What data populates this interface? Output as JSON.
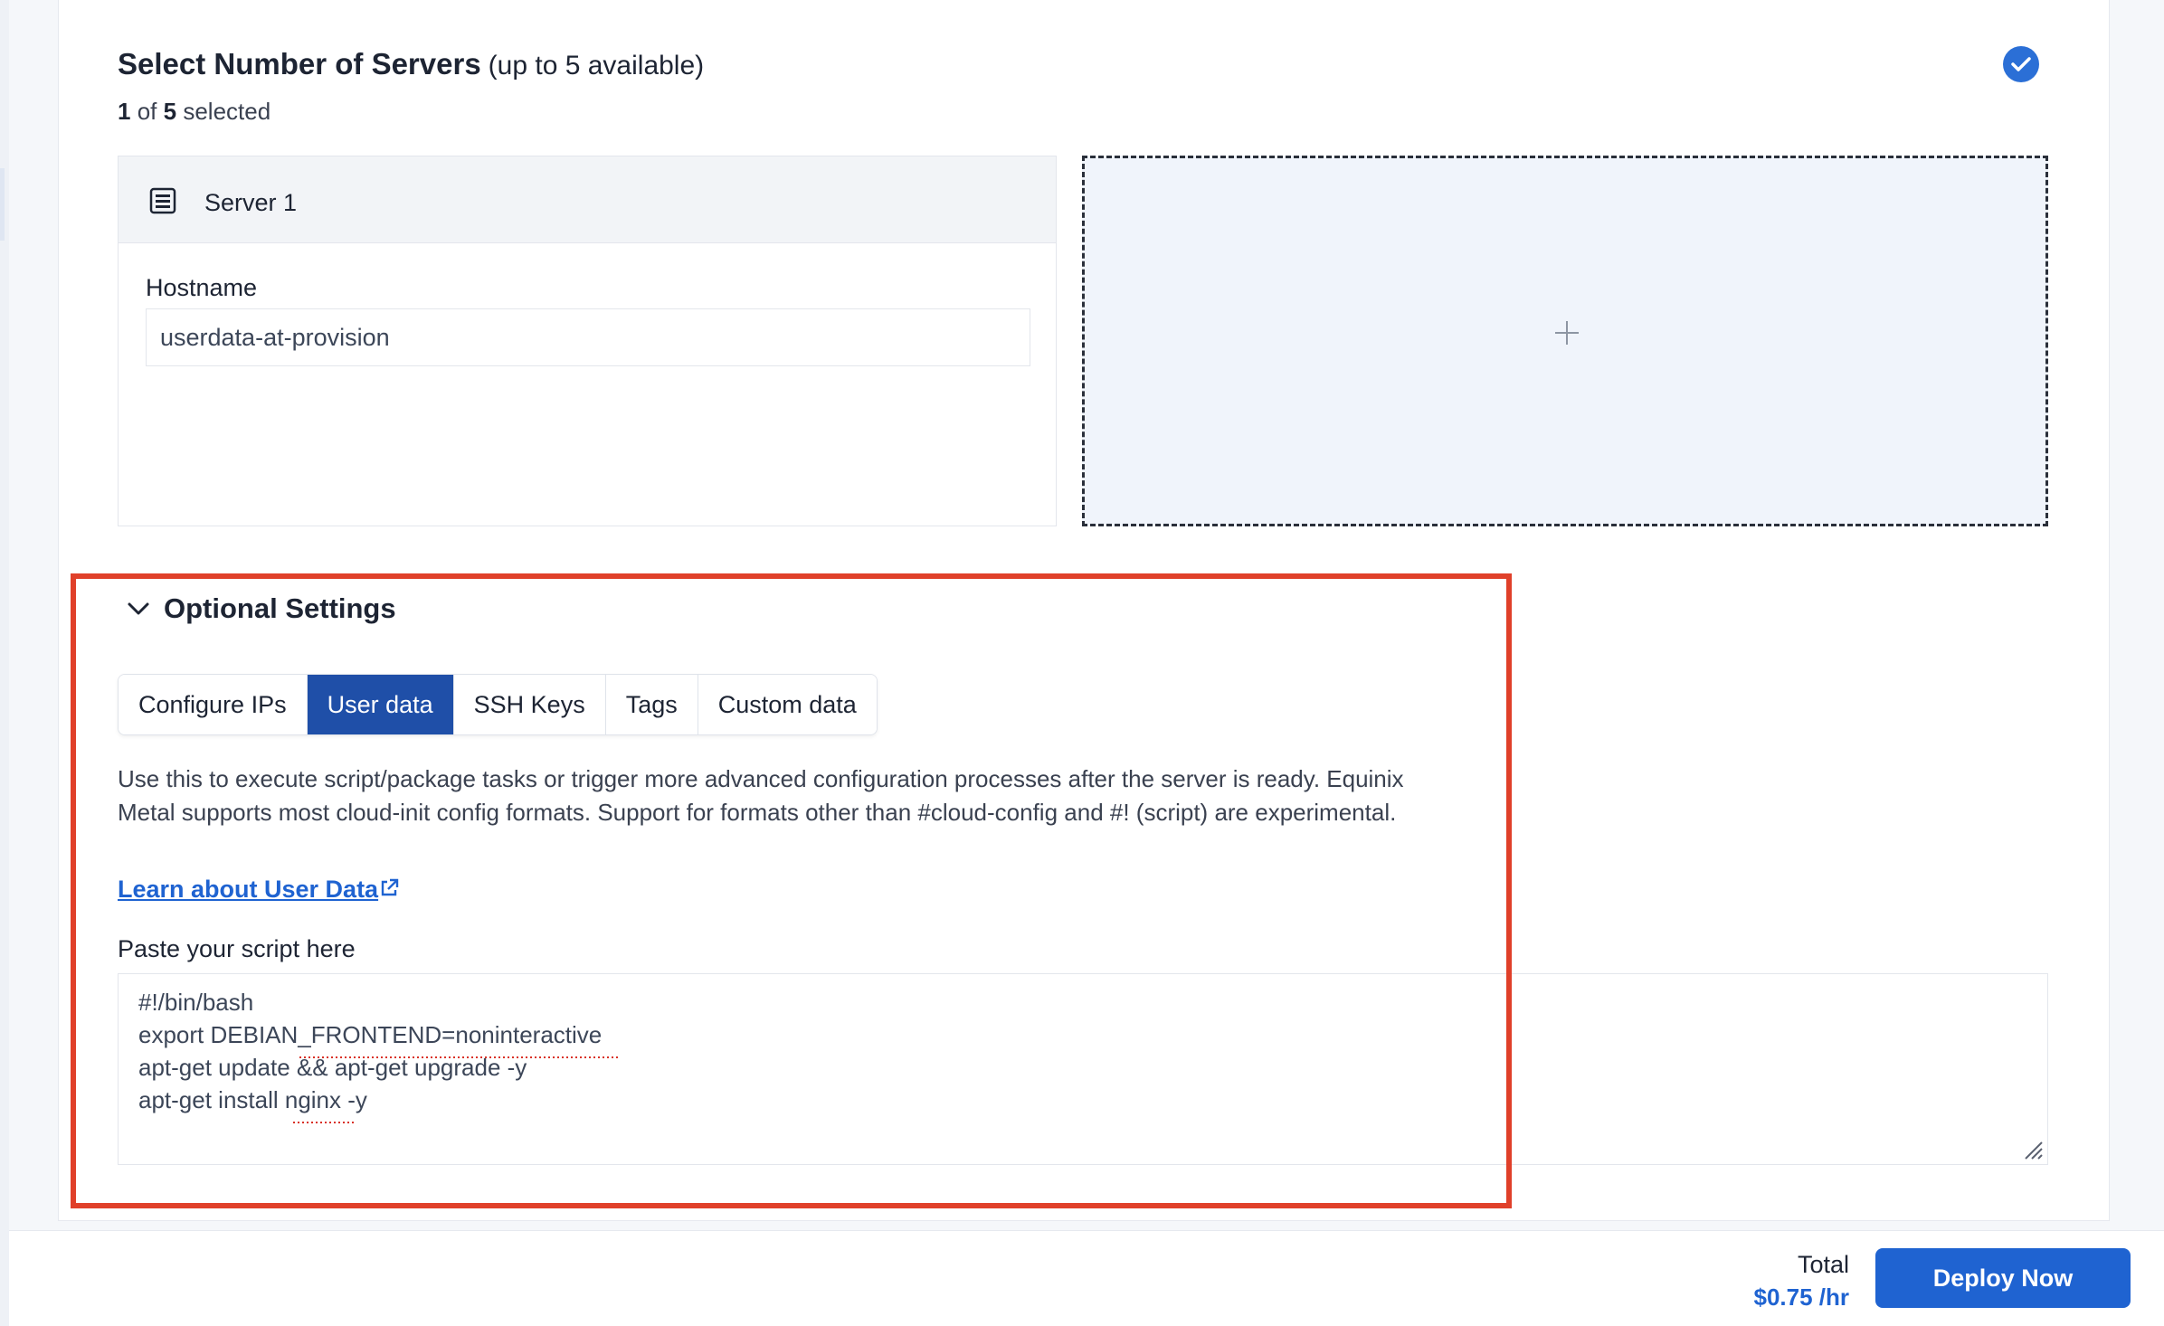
{
  "header": {
    "title": "Select Number of Servers",
    "title_suffix": "(up to 5 available)",
    "selected_count": "1",
    "of_label": "of",
    "total_available": "5",
    "selected_label": "selected"
  },
  "server": {
    "label": "Server 1",
    "hostname_label": "Hostname",
    "hostname_value": "userdata-at-provision"
  },
  "optional": {
    "title": "Optional Settings",
    "tabs": [
      {
        "label": "Configure IPs",
        "active": false
      },
      {
        "label": "User data",
        "active": true
      },
      {
        "label": "SSH Keys",
        "active": false
      },
      {
        "label": "Tags",
        "active": false
      },
      {
        "label": "Custom data",
        "active": false
      }
    ],
    "description": "Use this to execute script/package tasks or trigger more advanced configuration processes after the server is ready. Equinix Metal supports most cloud-init config formats. Support for formats other than #cloud-config and #! (script) are experimental.",
    "learn_link": "Learn about User Data",
    "paste_label": "Paste your script here",
    "script_lines": [
      "#!/bin/bash",
      "export DEBIAN_FRONTEND=noninteractive",
      "apt-get update && apt-get upgrade -y",
      "apt-get install nginx -y"
    ]
  },
  "footer": {
    "total_label": "Total",
    "total_price": "$0.75 /hr",
    "deploy_label": "Deploy Now"
  },
  "colors": {
    "accent": "#1f63d1",
    "active_tab": "#1f4fa8",
    "highlight": "#e0402a"
  }
}
